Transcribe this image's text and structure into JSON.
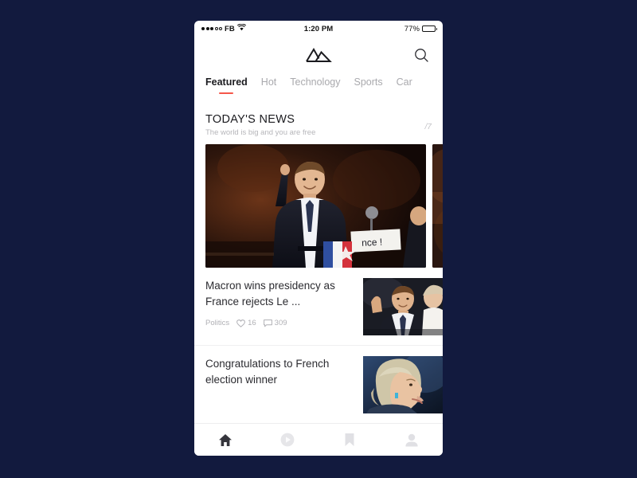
{
  "background_color": "#121a3e",
  "status_bar": {
    "signal_dots_filled": 3,
    "signal_dots_total": 5,
    "carrier": "FB",
    "wifi_icon": "wifi-icon",
    "time": "1:20 PM",
    "battery_percent": "77%",
    "battery_level": 77
  },
  "top_bar": {
    "logo_icon": "mountain-logo-icon",
    "search_icon": "search-icon"
  },
  "tabs": [
    {
      "label": "Featured",
      "active": true
    },
    {
      "label": "Hot",
      "active": false
    },
    {
      "label": "Technology",
      "active": false
    },
    {
      "label": "Sports",
      "active": false
    },
    {
      "label": "Car",
      "active": false
    }
  ],
  "section": {
    "title": "TODAY'S NEWS",
    "subtitle": "The world is big and you are free",
    "count": "/7"
  },
  "hero": {
    "alt": "Emmanuel Macron raising arm on stage at victory rally",
    "peek_alt": "next-article-preview"
  },
  "articles": [
    {
      "title": "Macron wins presidency as France rejects Le ...",
      "category": "Politics",
      "likes": "16",
      "comments": "309",
      "like_icon": "heart-icon",
      "comment_icon": "comment-icon",
      "thumb_alt": "Macron and Brigitte Macron waving"
    },
    {
      "title": "Congratulations to French election winner",
      "category": "",
      "likes": "",
      "comments": "",
      "thumb_alt": "Hillary Clinton smiling in profile"
    }
  ],
  "bottom_nav": [
    {
      "icon": "home-icon",
      "active": true
    },
    {
      "icon": "play-circle-icon",
      "active": false
    },
    {
      "icon": "bookmark-icon",
      "active": false
    },
    {
      "icon": "profile-icon",
      "active": false
    }
  ],
  "colors": {
    "accent": "#f5564a",
    "text_primary": "#1b1b1f",
    "text_muted": "#a9a9ad"
  }
}
